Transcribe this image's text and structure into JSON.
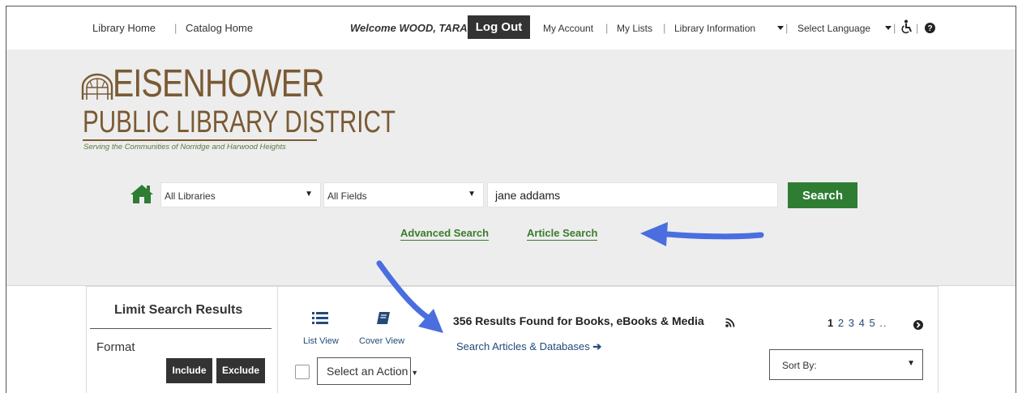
{
  "topnav": {
    "library_home": "Library Home",
    "catalog_home": "Catalog Home",
    "welcome": "Welcome WOOD, TARA",
    "logout": "Log Out",
    "my_account": "My Account",
    "my_lists": "My Lists",
    "library_information": "Library Information",
    "select_language": "Select Language",
    "separator": "|"
  },
  "logo": {
    "line1": "EISENHOWER",
    "line2": "PUBLIC LIBRARY DISTRICT",
    "tagline": "Serving the Communities of Norridge and Harwood Heights",
    "color": "#7a5a34"
  },
  "search": {
    "library_select": "All Libraries",
    "field_select": "All Fields",
    "query": "jane addams",
    "button": "Search",
    "advanced": "Advanced Search",
    "article": "Article Search",
    "accent": "#2e7d32"
  },
  "sidebar": {
    "title": "Limit Search Results",
    "format_label": "Format",
    "include": "Include",
    "exclude": "Exclude"
  },
  "results": {
    "list_view": "List View",
    "cover_view": "Cover View",
    "title": "356 Results Found for Books, eBooks & Media",
    "articles_link": "Search Articles & Databases",
    "articles_arrow": "➔",
    "pages": [
      "1",
      "2",
      "3",
      "4",
      "5",
      ".."
    ],
    "action_select": "Select an Action",
    "sort_by": "Sort By:"
  },
  "annotations": {
    "arrow_color": "#4a6ee0"
  }
}
